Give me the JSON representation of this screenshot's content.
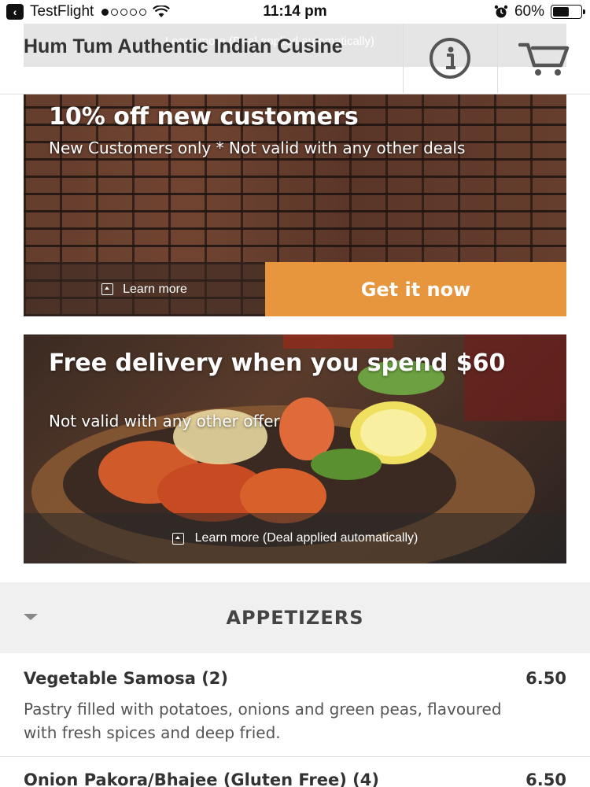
{
  "status_bar": {
    "carrier": "TestFlight",
    "time": "11:14 pm",
    "battery": "60%",
    "battery_level": 0.6
  },
  "header": {
    "ghost_text": "Learn more (Deal applied automatically)",
    "title": "Hum Tum Authentic Indian Cusine",
    "info_icon": "info-icon",
    "cart_icon": "cart-icon"
  },
  "deals": [
    {
      "title": "10% off new customers",
      "subtitle": "New Customers only * Not valid with any other deals",
      "learn_more": "Learn more",
      "cta": "Get it now"
    },
    {
      "title": "Free delivery when you spend $60",
      "subtitle": "Not valid with any other offer",
      "learn_more": "Learn more (Deal applied automatically)"
    }
  ],
  "category": {
    "title": "APPETIZERS"
  },
  "menu_items": [
    {
      "name": "Vegetable Samosa (2)",
      "price": "6.50",
      "description": "Pastry filled with potatoes, onions and green peas, flavoured with fresh spices and deep fried."
    },
    {
      "name": "Onion Pakora/Bhajee (Gluten Free) (4)",
      "price": "6.50"
    }
  ],
  "colors": {
    "accent": "#e8963e",
    "category_bg": "#f0f0f0"
  }
}
